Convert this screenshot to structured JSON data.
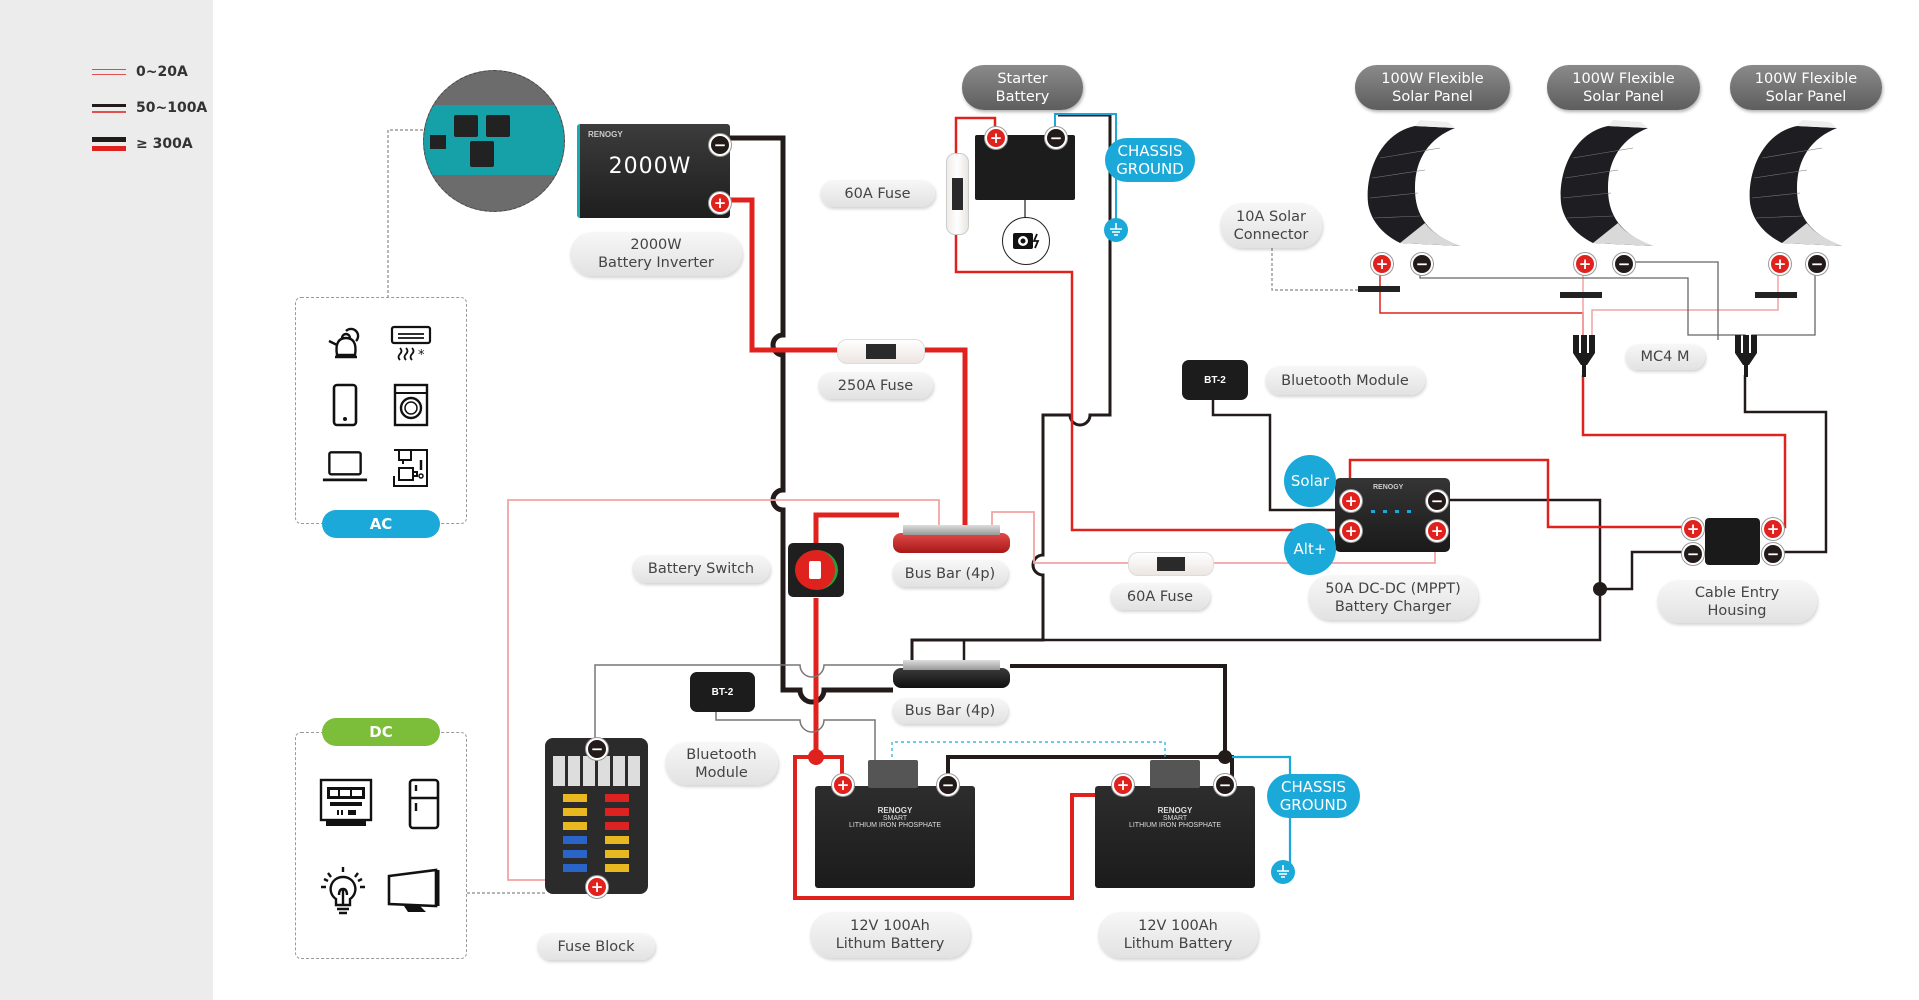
{
  "legend": {
    "items": [
      {
        "label": "0~20A",
        "weight": "thin"
      },
      {
        "label": "50~100A",
        "weight": "medium"
      },
      {
        "label": "≥ 300A",
        "weight": "thick"
      }
    ]
  },
  "colors": {
    "positive_wire": "#e0221f",
    "negative_wire": "#221b1a",
    "light_positive_wire": "#f4a3a3",
    "thin_negative_wire": "#666666",
    "ground_wire": "#1aa9d8",
    "ac_pill": "#1aa9d8",
    "dc_pill": "#7cbd3a",
    "sidebar_bg": "#ececec"
  },
  "components": {
    "inverter": {
      "display": "2000W",
      "brand": "RENOGY",
      "label": "2000W\nBattery Inverter"
    },
    "starter_battery": {
      "label": "Starter\nBattery"
    },
    "chassis_ground_top": {
      "label": "CHASSIS\nGROUND"
    },
    "fuse_60a_top": {
      "label": "60A Fuse"
    },
    "fuse_250a": {
      "label": "250A Fuse"
    },
    "solar_connector": {
      "label": "10A Solar\nConnector"
    },
    "solar_panels": [
      {
        "label": "100W Flexible\nSolar Panel"
      },
      {
        "label": "100W Flexible\nSolar Panel"
      },
      {
        "label": "100W Flexible\nSolar Panel"
      }
    ],
    "mc4": {
      "label": "MC4 M"
    },
    "bluetooth_top": {
      "label": "Bluetooth Module",
      "device_text": "BT-2"
    },
    "dcdc_charger": {
      "label": "50A DC-DC (MPPT)\nBattery Charger",
      "brand": "RENOGY",
      "solar_tag": "Solar",
      "alt_tag": "Alt+"
    },
    "cable_entry": {
      "label": "Cable Entry\nHousing"
    },
    "battery_switch": {
      "label": "Battery Switch"
    },
    "bus_bar_pos": {
      "label": "Bus Bar (4p)"
    },
    "fuse_60a_bottom": {
      "label": "60A Fuse"
    },
    "bus_bar_neg": {
      "label": "Bus Bar (4p)"
    },
    "bluetooth_bottom": {
      "label": "Bluetooth\nModule",
      "device_text": "BT-2"
    },
    "fuse_block": {
      "label": "Fuse Block"
    },
    "battery_1": {
      "label": "12V 100Ah\nLithum Battery",
      "brand": "RENOGY",
      "line1": "SMART",
      "line2": "LITHIUM IRON PHOSPHATE"
    },
    "battery_2": {
      "label": "12V 100Ah\nLithum Battery",
      "brand": "RENOGY",
      "line1": "SMART",
      "line2": "LITHIUM IRON PHOSPHATE"
    },
    "chassis_ground_bottom": {
      "label": "CHASSIS\nGROUND"
    }
  },
  "loads": {
    "ac": {
      "label": "AC",
      "icons": [
        "kettle-icon",
        "air-conditioner-icon",
        "smartphone-icon",
        "washing-machine-icon",
        "laptop-icon",
        "coffee-maker-icon"
      ]
    },
    "dc": {
      "label": "DC",
      "icons": [
        "microwave-icon",
        "fridge-icon",
        "light-bulb-icon",
        "tv-icon"
      ]
    }
  },
  "terminals": {
    "pos": "+",
    "neg": "−"
  }
}
